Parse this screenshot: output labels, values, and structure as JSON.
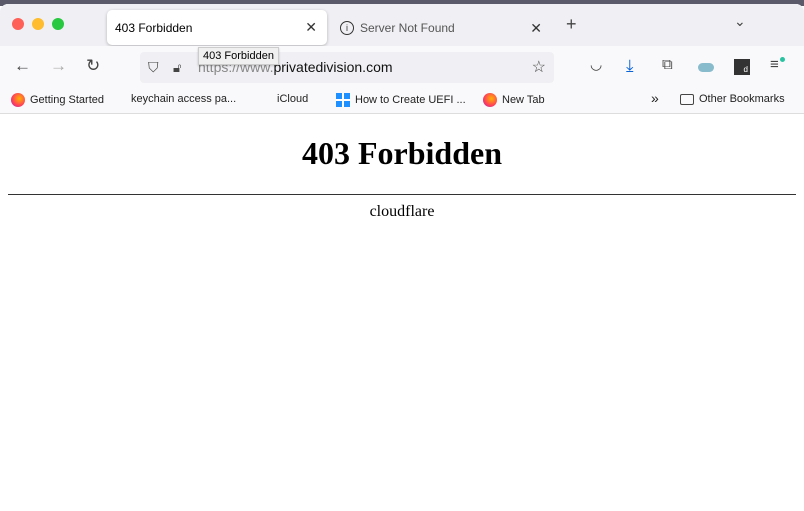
{
  "tabs": [
    {
      "title": "403 Forbidden",
      "active": true
    },
    {
      "title": "Server Not Found",
      "active": false
    }
  ],
  "tooltip": "403 Forbidden",
  "address": {
    "protocol": "https://www.",
    "domain": "privatedivision.com"
  },
  "bookmarks": [
    {
      "label": "Getting Started",
      "icon": "firefox-icon"
    },
    {
      "label": "keychain access pa...",
      "icon": "apple-icon"
    },
    {
      "label": "iCloud",
      "icon": "apple-icon"
    },
    {
      "label": "How to Create UEFI ...",
      "icon": "windows-icon"
    },
    {
      "label": "New Tab",
      "icon": "firefox-icon"
    }
  ],
  "other_bookmarks": "Other Bookmarks",
  "page": {
    "heading": "403 Forbidden",
    "server": "cloudflare"
  }
}
